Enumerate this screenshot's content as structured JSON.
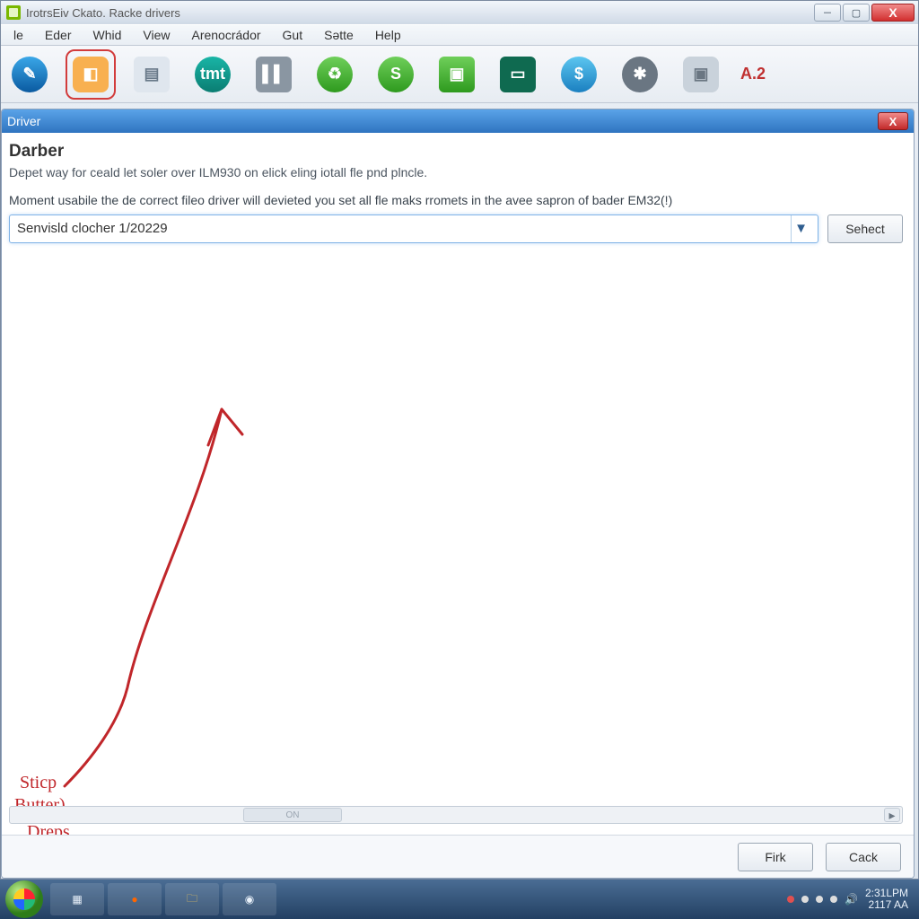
{
  "window": {
    "title": "IrotrsEiv Ckato. Racke drivers"
  },
  "menu": {
    "items": [
      "le",
      "Eder",
      "Whid",
      "View",
      "Arenocrádor",
      "Gut",
      "Sətte",
      "Help"
    ]
  },
  "toolbar": {
    "version_label": "A.2"
  },
  "dialog": {
    "title": "Driver",
    "heading": "Darber",
    "desc1": "Depet way for ceald let soler over ILM930 on elick eling iotall fle pnd plncle.",
    "desc2": "Moment usabile the de correct fileo driver will devieted you set all fle maks rromets in the avee sapron of bader EM32(!)",
    "combo_value": "Senvisld clocher 1/20229",
    "select_label": "Sehect",
    "scroll_thumb_label": "ON",
    "footer": {
      "primary": "Firk",
      "secondary": "Cack"
    }
  },
  "annotation": {
    "line1": "Sticp",
    "line2": "Butter)",
    "line3": "Dreps"
  },
  "taskbar": {
    "time": "2:31LPM",
    "date": "2117 AA"
  }
}
